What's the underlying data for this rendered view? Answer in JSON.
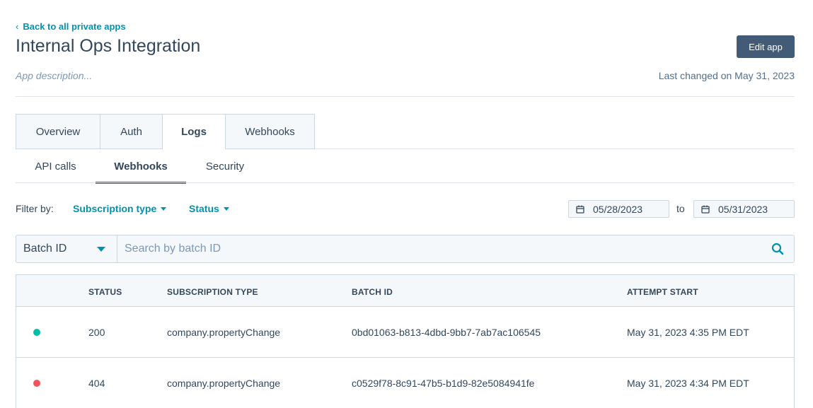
{
  "header": {
    "back_link": "Back to all private apps",
    "title": "Internal Ops Integration",
    "edit_button": "Edit app",
    "description_placeholder": "App description...",
    "last_changed": "Last changed on May 31, 2023"
  },
  "tabs": [
    {
      "label": "Overview",
      "active": false
    },
    {
      "label": "Auth",
      "active": false
    },
    {
      "label": "Logs",
      "active": true
    },
    {
      "label": "Webhooks",
      "active": false
    }
  ],
  "subtabs": [
    {
      "label": "API calls",
      "active": false
    },
    {
      "label": "Webhooks",
      "active": true
    },
    {
      "label": "Security",
      "active": false
    }
  ],
  "filters": {
    "label": "Filter by:",
    "subscription_type": "Subscription type",
    "status": "Status",
    "date_from": "05/28/2023",
    "to_label": "to",
    "date_to": "05/31/2023"
  },
  "search": {
    "field_select": "Batch ID",
    "placeholder": "Search by batch ID"
  },
  "table": {
    "columns": [
      "STATUS",
      "SUBSCRIPTION TYPE",
      "BATCH ID",
      "ATTEMPT START"
    ],
    "rows": [
      {
        "status_color": "#00bda5",
        "status": "200",
        "subscription_type": "company.propertyChange",
        "batch_id": "0bd01063-b813-4dbd-9bb7-7ab7ac106545",
        "attempt_start": "May 31, 2023 4:35 PM EDT"
      },
      {
        "status_color": "#f2545b",
        "status": "404",
        "subscription_type": "company.propertyChange",
        "batch_id": "c0529f78-8c91-47b5-b1d9-82e5084941fe",
        "attempt_start": "May 31, 2023 4:34 PM EDT"
      }
    ]
  },
  "colors": {
    "accent": "#0091ae",
    "primary_button": "#425b76",
    "success": "#00bda5",
    "error": "#f2545b"
  }
}
